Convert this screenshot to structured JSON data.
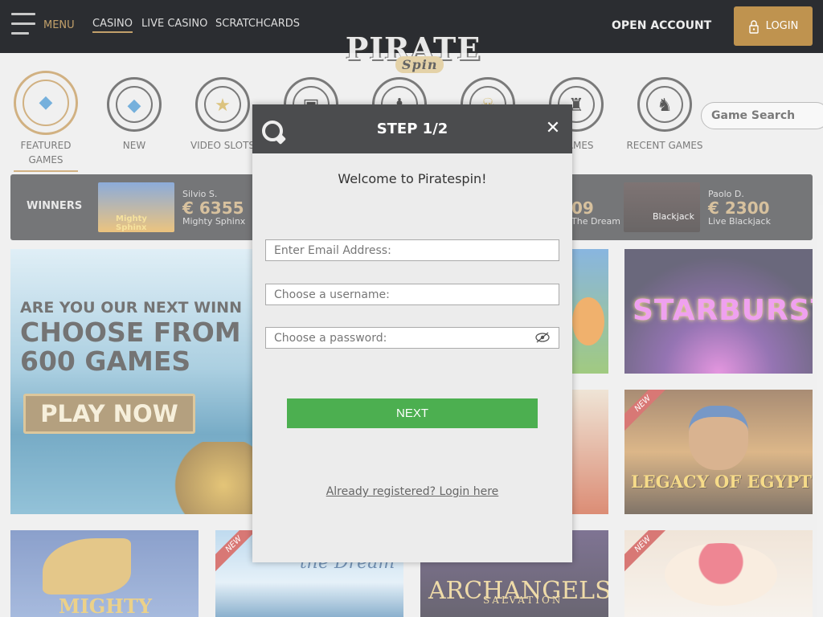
{
  "header": {
    "menu_label": "MENU",
    "nav": [
      "CASINO",
      "LIVE CASINO",
      "SCRATCHCARDS"
    ],
    "open_account": "OPEN ACCOUNT",
    "login": "LOGIN",
    "logo_main": "PIRATE",
    "logo_sub": "Spin",
    "icons": {
      "menu": "hamburger-icon",
      "login": "lock-icon"
    }
  },
  "categories": [
    {
      "label": "FEATURED GAMES",
      "icon": "diamond-icon"
    },
    {
      "label": "NEW",
      "icon": "diamond-icon"
    },
    {
      "label": "VIDEO SLOTS",
      "icon": "star-icon"
    },
    {
      "label": "",
      "icon": "slot-icon"
    },
    {
      "label": "",
      "icon": "pirate-icon"
    },
    {
      "label": "",
      "icon": "skull-icon"
    },
    {
      "label": "GAMES",
      "icon": "pirate-hat-icon"
    },
    {
      "label": "RECENT GAMES",
      "icon": "pirate-face-icon"
    }
  ],
  "search": {
    "label": "Game Search"
  },
  "winners": {
    "title": "WINNERS",
    "items": [
      {
        "name": "Silvio S.",
        "amount": "€ 6355",
        "game": "Mighty Sphinx",
        "thumb_text": "Mighty Sphinx"
      },
      {
        "name": "",
        "amount": "09",
        "game": "The Dream",
        "thumb_text": ""
      },
      {
        "name": "Paolo D.",
        "amount": "€ 2300",
        "game": "Live Blackjack",
        "thumb_text": "Blackjack"
      }
    ]
  },
  "hero": {
    "line1": "ARE YOU OUR NEXT WINN",
    "line2": "CHOOSE FROM",
    "line3": "600 GAMES",
    "cta": "PLAY NOW"
  },
  "tiles": {
    "starburst": "STARBURST",
    "egypt": "LEGACY OF EGYPT",
    "sphinx": "MIGHTY",
    "dream": "the Dream",
    "archangels": "ARCHANGELS",
    "archangels_sub": "SALVATION",
    "new_badge": "NEW"
  },
  "modal": {
    "title": "STEP 1/2",
    "welcome": "Welcome to Piratespin!",
    "email_placeholder": "Enter Email Address:",
    "username_placeholder": "Choose a username:",
    "password_placeholder": "Choose a password:",
    "next": "NEXT",
    "login_link": "Already registered? Login here",
    "icons": {
      "brand": "brand-logo-icon",
      "close": "close-icon",
      "eye": "eye-hidden-icon"
    }
  },
  "colors": {
    "accent": "#bf934f",
    "header_bg": "#2b2d31",
    "next_green": "#4caf50"
  }
}
